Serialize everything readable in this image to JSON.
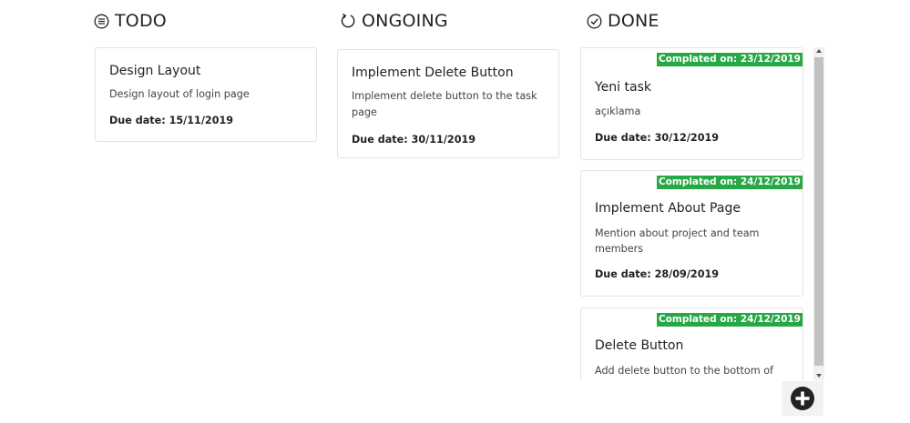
{
  "columns": {
    "todo": {
      "title": "TODO",
      "icon": "list-icon",
      "cards": [
        {
          "title": "Design Layout",
          "description": "Design layout of login page",
          "due": "Due date: 15/11/2019"
        }
      ]
    },
    "ongoing": {
      "title": "ONGOING",
      "icon": "refresh-icon",
      "cards": [
        {
          "title": "Implement Delete Button",
          "description_lines": [
            "Implement delete button to the task",
            "page"
          ],
          "due": "Due date: 30/11/2019"
        }
      ]
    },
    "done": {
      "title": "DONE",
      "icon": "check-circle-icon",
      "cards": [
        {
          "badge": "Complated on: 23/12/2019",
          "title": "Yeni task",
          "description": "açıklama",
          "due": "Due date: 30/12/2019"
        },
        {
          "badge": "Complated on: 24/12/2019",
          "title": "Implement About Page",
          "description_lines": [
            "Mention about project and team",
            "members"
          ],
          "due": "Due date: 28/09/2019"
        },
        {
          "badge": "Complated on: 24/12/2019",
          "title": "Delete Button",
          "description": "Add delete button to the bottom of"
        }
      ]
    }
  },
  "colors": {
    "badge": "#28a745",
    "card_border": "#e3e3e3",
    "add_button": "#222222"
  },
  "add_button": {
    "icon": "plus-circle-icon"
  }
}
